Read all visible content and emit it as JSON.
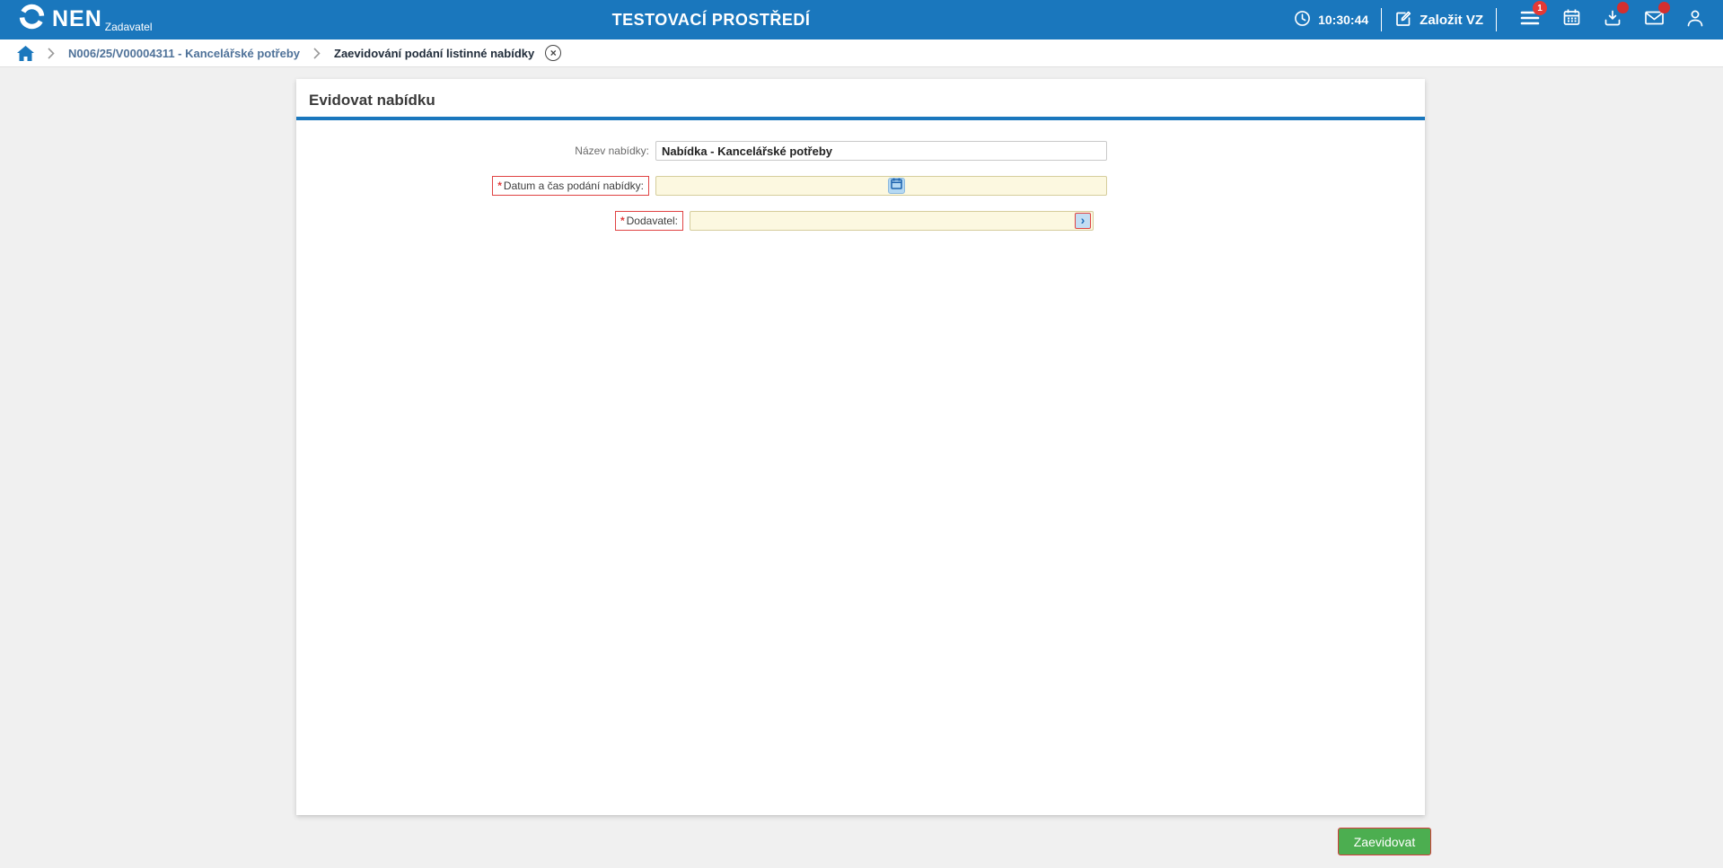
{
  "header": {
    "brand": {
      "name": "NEN",
      "role": "Zadavatel"
    },
    "environment": "TESTOVACÍ PROSTŘEDÍ",
    "time": "10:30:44",
    "create_vz_label": "Založit VZ",
    "menu_badge": "1"
  },
  "breadcrumb": {
    "items": [
      "N006/25/V00004311 - Kancelářské potřeby",
      "Zaevidování podání listinné nabídky"
    ]
  },
  "page": {
    "title": "Evidovat nabídku"
  },
  "form": {
    "required_marker": "*",
    "fields": {
      "nazev": {
        "label": "Název nabídky:",
        "value": "Nabídka - Kancelářské potřeby"
      },
      "datum": {
        "label": "Datum a čas podání nabídky:",
        "value": ""
      },
      "dodavatel": {
        "label": "Dodavatel:",
        "value": ""
      }
    }
  },
  "actions": {
    "submit": "Zaevidovat"
  },
  "icons": {
    "close_glyph": "×",
    "lookup_glyph": "›"
  },
  "colors": {
    "header_bg": "#1a77bd",
    "accent": "#1a77bd",
    "required_red": "#e04343",
    "field_yellow": "#fcf8e0",
    "submit_green": "#4cae50",
    "badge_red": "#e53935"
  }
}
